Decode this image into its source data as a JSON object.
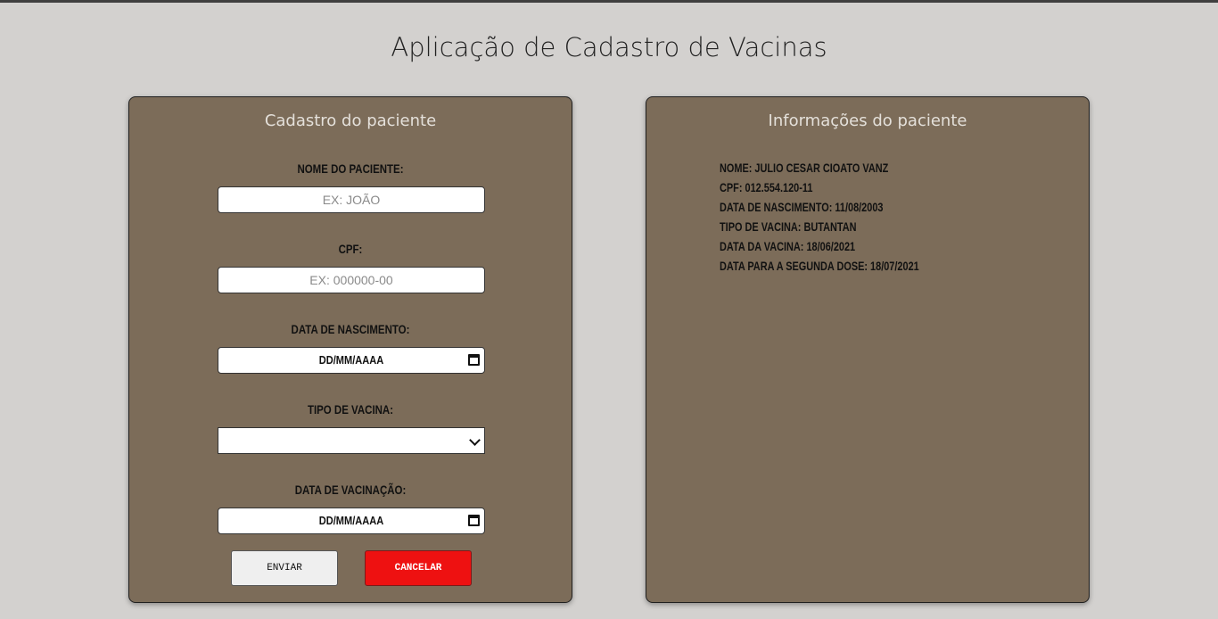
{
  "app": {
    "title": "Aplicação de Cadastro de Vacinas"
  },
  "form": {
    "title": "Cadastro do paciente",
    "fields": {
      "name": {
        "label": "NOME DO PACIENTE:",
        "placeholder": "EX: JOÃO",
        "value": ""
      },
      "cpf": {
        "label": "CPF:",
        "placeholder": "EX: 000000-00",
        "value": ""
      },
      "birth_date": {
        "label": "DATA DE NASCIMENTO:",
        "display": "DD/MM/AAAA"
      },
      "vaccine_type": {
        "label": "TIPO DE VACINA:",
        "selected": ""
      },
      "vaccination_date": {
        "label": "DATA DE VACINAÇÃO:",
        "display": "DD/MM/AAAA"
      }
    },
    "buttons": {
      "send": "ENVIAR",
      "cancel": "CANCELAR"
    }
  },
  "info": {
    "title": "Informações do paciente",
    "lines": [
      "NOME: JULIO CESAR CIOATO VANZ",
      "CPF: 012.554.120-11",
      "DATA DE NASCIMENTO: 11/08/2003",
      "TIPO DE VACINA: BUTANTAN",
      "DATA DA VACINA: 18/06/2021",
      "DATA PARA A SEGUNDA DOSE: 18/07/2021"
    ]
  },
  "colors": {
    "background": "#d3d1cf",
    "panel": "#7c6c59",
    "cancel_button": "#ee1111"
  }
}
